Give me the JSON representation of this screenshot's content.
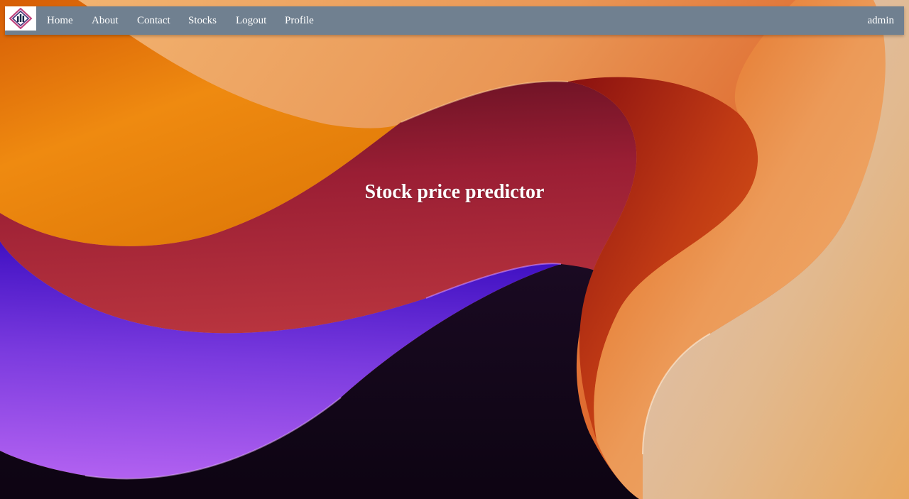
{
  "nav": {
    "logo_icon": "stock-chart-diamond-logo",
    "links": [
      {
        "label": "Home"
      },
      {
        "label": "About"
      },
      {
        "label": "Contact"
      },
      {
        "label": "Stocks"
      },
      {
        "label": "Logout"
      },
      {
        "label": "Profile"
      }
    ],
    "user": "admin"
  },
  "hero": {
    "title": "Stock price predictor"
  },
  "theme": {
    "navbar_color": "#708090",
    "text_color": "#ffffff",
    "background_colors": [
      "#f0a050",
      "#e87e10",
      "#a0203a",
      "#6a2ad8",
      "#120818",
      "#ddc0b8"
    ]
  }
}
